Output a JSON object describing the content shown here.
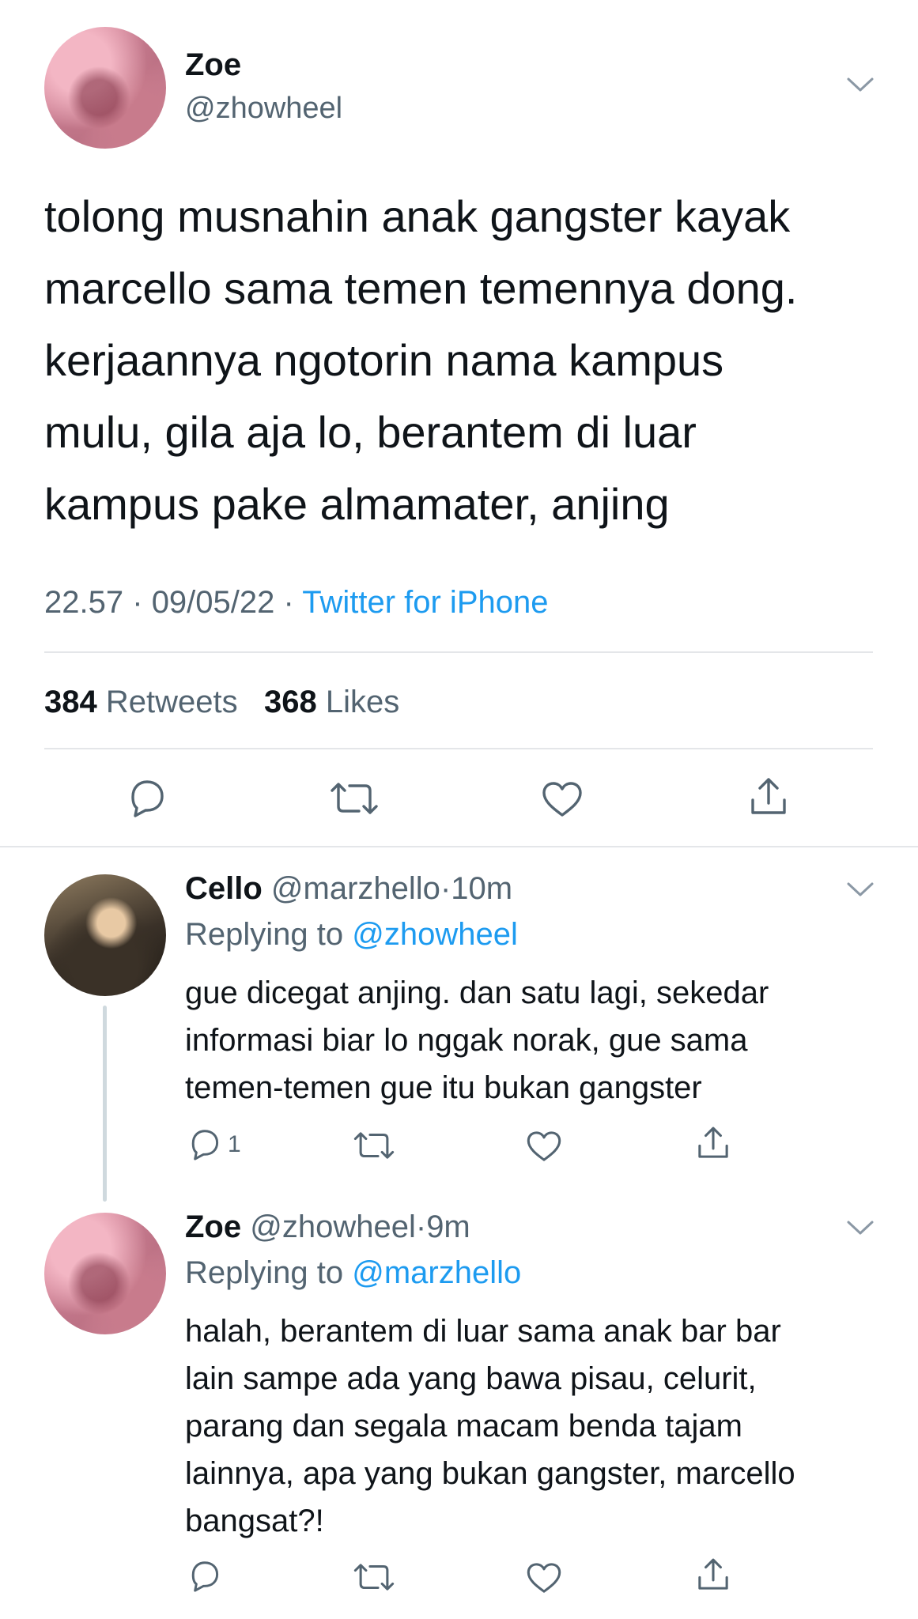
{
  "tweet": {
    "author_name": "Zoe",
    "author_handle": "@zhowheel",
    "text_lines": [
      "tolong musnahin anak gangster kayak",
      "marcello sama temen temennya dong.",
      "kerjaannya ngotorin nama kampus",
      "mulu, gila aja lo, berantem di luar",
      "kampus pake almamater, anjing"
    ],
    "time": "22.57",
    "date": "09/05/22",
    "separator": "·",
    "source": "Twitter for iPhone",
    "retweets_count": "384",
    "retweets_label": "Retweets",
    "likes_count": "368",
    "likes_label": "Likes"
  },
  "replies": [
    {
      "name": "Cello",
      "handle": "@marzhello",
      "separator": "·",
      "time": "10m",
      "replying_label": "Replying to",
      "replying_to": "@zhowheel",
      "text_lines": [
        "gue dicegat anjing. dan satu lagi, sekedar",
        "informasi biar lo nggak norak, gue sama",
        "temen-temen gue itu bukan gangster"
      ],
      "reply_count": "1"
    },
    {
      "name": "Zoe",
      "handle": "@zhowheel",
      "separator": "·",
      "time": "9m",
      "replying_label": "Replying to",
      "replying_to": "@marzhello",
      "text_lines": [
        "halah, berantem di luar sama anak bar bar",
        "lain sampe ada yang bawa pisau, celurit,",
        "parang dan segala macam benda tajam",
        "lainnya, apa yang bukan gangster, marcello",
        "bangsat?!"
      ],
      "reply_count": ""
    }
  ],
  "colors": {
    "text": "#0f1419",
    "secondary": "#536471",
    "link": "#1d9bf0",
    "divider": "#e4e6e9"
  },
  "icons": [
    "chevron-down-icon",
    "reply-icon",
    "retweet-icon",
    "like-icon",
    "share-icon"
  ]
}
